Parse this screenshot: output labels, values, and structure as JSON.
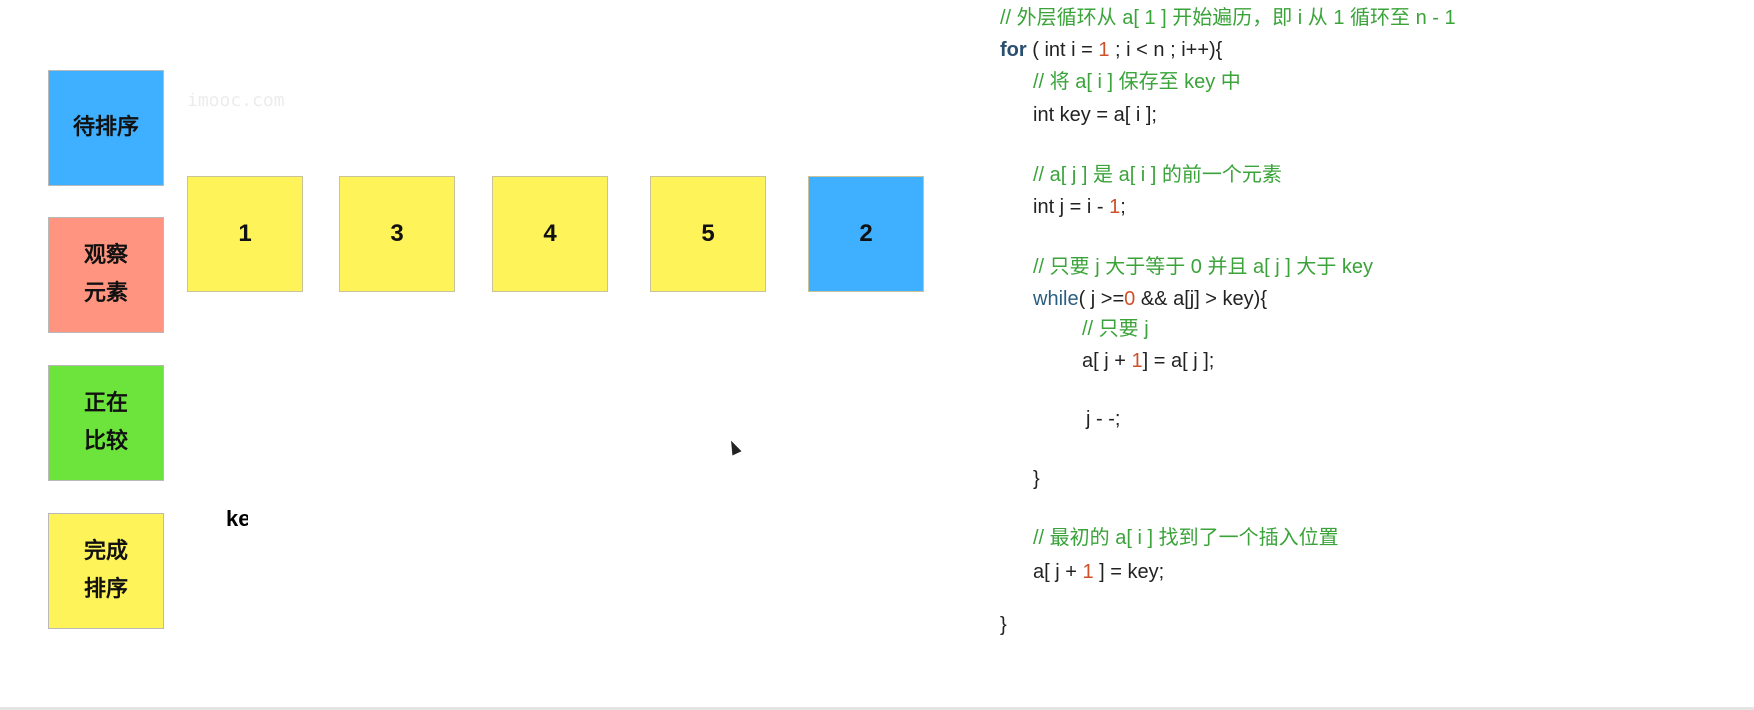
{
  "legend": [
    {
      "label_lines": [
        "待排序"
      ],
      "color": "#3fb0ff"
    },
    {
      "label_lines": [
        "观察",
        "元素"
      ],
      "color": "#ff9580"
    },
    {
      "label_lines": [
        "正在",
        "比较"
      ],
      "color": "#6de43c"
    },
    {
      "label_lines": [
        "完成",
        "排序"
      ],
      "color": "#fff35a"
    }
  ],
  "array": [
    {
      "value": "1",
      "state": "sorted"
    },
    {
      "value": "3",
      "state": "sorted"
    },
    {
      "value": "4",
      "state": "sorted"
    },
    {
      "value": "5",
      "state": "sorted"
    },
    {
      "value": "2",
      "state": "unsorted"
    }
  ],
  "key_label": "key",
  "watermark": "imooc.com",
  "code": {
    "l1": "// 外层循环从 a[ 1 ] 开始遍历，即 i 从 1 循环至 n - 1",
    "l2_kw": "for",
    "l2_a": " ( int i = ",
    "l2_num": "1",
    "l2_b": " ; i < n ; i++){",
    "l3": "// 将 a[ i ] 保存至 key 中",
    "l4": "int key = a[ i ];",
    "l5": "// a[ j ] 是 a[ i ] 的前一个元素",
    "l6_a": "int j = i - ",
    "l6_num": "1",
    "l6_b": ";",
    "l7": "// 只要 j 大于等于 0 并且 a[ j ] 大于 key",
    "l8_kw": "while",
    "l8_a": "( j >=",
    "l8_num": "0",
    "l8_b": " && a[j] > key){",
    "l9": "// 只要 j",
    "l10_a": "a[ j + ",
    "l10_num": "1",
    "l10_b": "] = a[ j ];",
    "l11": "j - -;",
    "l12": "}",
    "l13": "// 最初的 a[ i ] 找到了一个插入位置",
    "l14_a": "a[ j + ",
    "l14_num": "1",
    "l14_b": " ] = key;",
    "l15": "}"
  }
}
